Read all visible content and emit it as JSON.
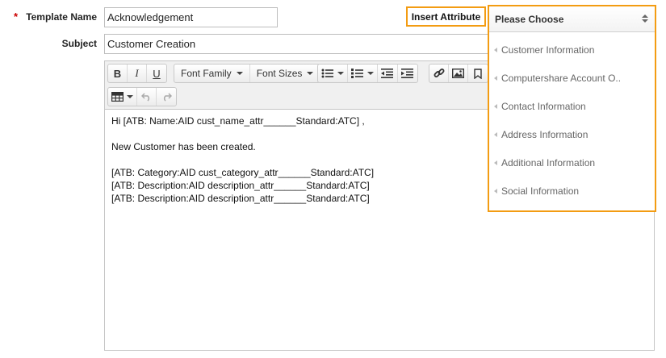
{
  "form": {
    "required_mark": "*",
    "template_name_label": "Template Name",
    "template_name_value": "Acknowledgement",
    "subject_label": "Subject",
    "subject_value": "Customer Creation",
    "insert_attribute_label": "Insert Attribute"
  },
  "toolbar": {
    "bold": "B",
    "italic": "I",
    "underline": "U",
    "font_family": "Font Family",
    "font_sizes": "Font Sizes"
  },
  "editor_content": {
    "line1": "Hi [ATB: Name:AID cust_name_attr______Standard:ATC] ,",
    "line2": "New Customer has been created.",
    "line3": "[ATB: Category:AID cust_category_attr______Standard:ATC]",
    "line4": "[ATB: Description:AID description_attr______Standard:ATC]",
    "line5": "[ATB: Description:AID description_attr______Standard:ATC]"
  },
  "dropdown": {
    "selected": "Please Choose",
    "options": [
      "Customer Information",
      "Computershare Account O..",
      "Contact Information",
      "Address Information",
      "Additional Information",
      "Social Information"
    ]
  },
  "colors": {
    "highlight": "#f39c12",
    "required": "#cc0000"
  }
}
